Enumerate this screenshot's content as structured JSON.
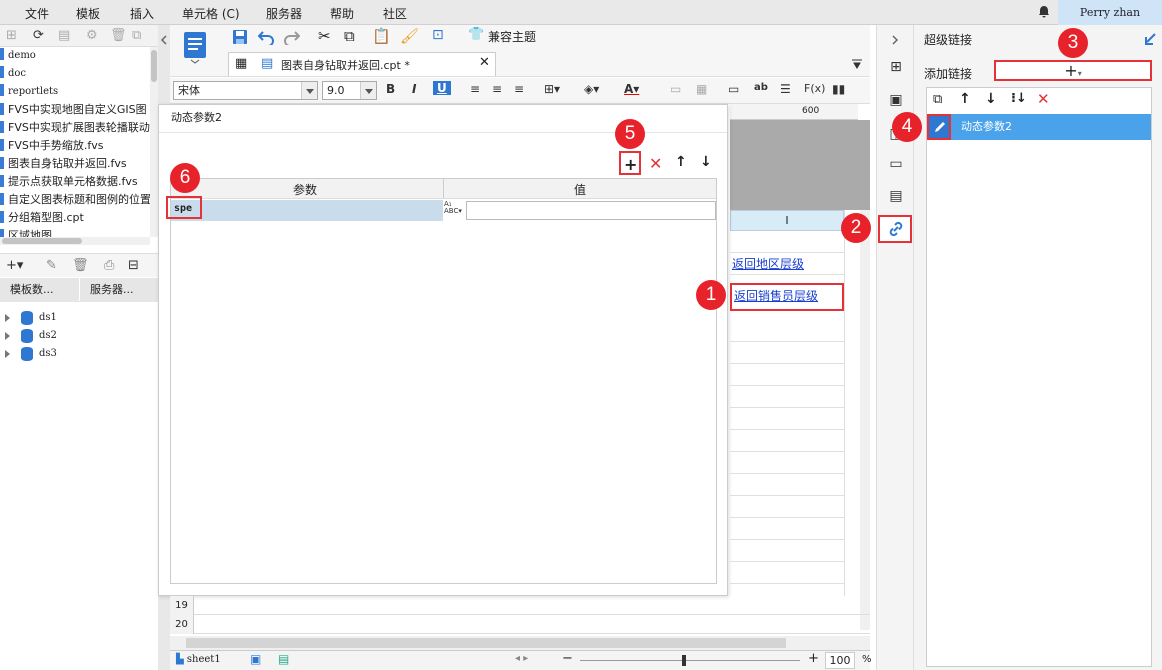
{
  "menu": [
    "文件",
    "模板",
    "插入",
    "单元格 (C)",
    "服务器",
    "帮助",
    "社区"
  ],
  "user": "Perry zhan",
  "files": [
    "demo",
    "doc",
    "reportlets",
    "FVS中实现地图自定义GIS图",
    "FVS中实现扩展图表轮播联动",
    "FVS中手势缩放.fvs",
    "图表自身钻取并返回.fvs",
    "提示点获取单元格数据.fvs",
    "自定义图表标题和图例的位置",
    "分组箱型图.cpt",
    "区域地图"
  ],
  "left_tabs": [
    "模板数...",
    "服务器..."
  ],
  "datasets": [
    "ds1",
    "ds2",
    "ds3"
  ],
  "toolbar": {
    "compat_theme": "兼容主题"
  },
  "doc_tab": "图表自身钻取并返回.cpt *",
  "format": {
    "font": "宋体",
    "size": "9.0"
  },
  "ruler_mark": "600",
  "dialog": {
    "title": "动态参数2",
    "col_param": "参数",
    "col_value": "值",
    "param_name": "spe"
  },
  "sheet": {
    "column": "I",
    "cells": [
      "返回地区层级",
      "返回销售员层级"
    ],
    "row_numbers": [
      "19",
      "20"
    ],
    "tab": "sheet1",
    "zoom": "100",
    "zoom_unit": "%"
  },
  "hyperlink_panel": {
    "title": "超级链接",
    "add_label": "添加链接",
    "item": "动态参数2"
  },
  "badges": [
    "1",
    "2",
    "3",
    "4",
    "5",
    "6"
  ],
  "colors": {
    "accent": "#4aa3ea",
    "badge": "#e8222a",
    "link": "#1a3ed0"
  }
}
